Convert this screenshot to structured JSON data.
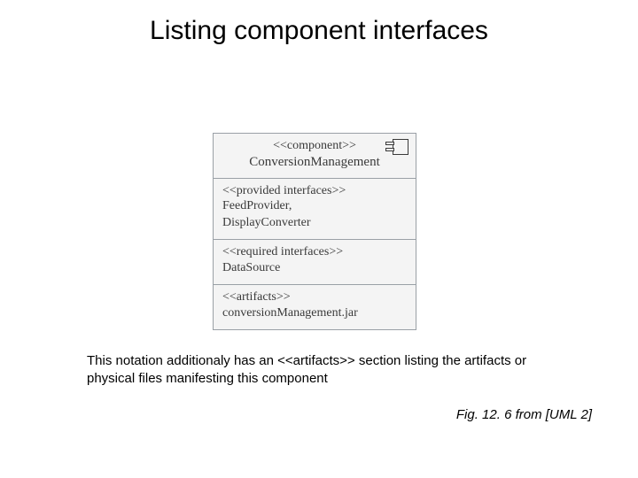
{
  "title": "Listing component interfaces",
  "diagram": {
    "header": {
      "stereotype": "<<component>>",
      "name": "ConversionManagement"
    },
    "provided": {
      "stereotype": "<<provided interfaces>>",
      "items": [
        "FeedProvider,",
        "DisplayConverter"
      ]
    },
    "required": {
      "stereotype": "<<required interfaces>>",
      "items": [
        "DataSource"
      ]
    },
    "artifacts": {
      "stereotype": "<<artifacts>>",
      "items": [
        "conversionManagement.jar"
      ]
    }
  },
  "caption": "This notation additionaly has an <<artifacts>> section listing the artifacts or physical files manifesting this component",
  "figref": "Fig. 12. 6 from [UML 2]"
}
